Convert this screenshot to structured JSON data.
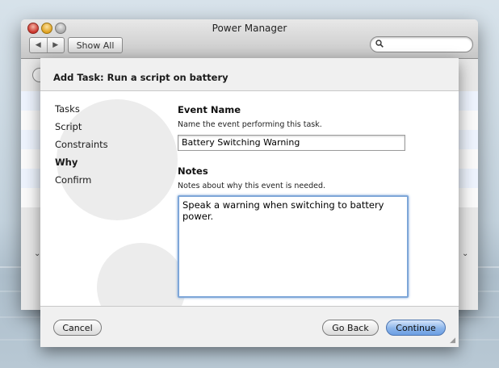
{
  "window": {
    "title": "Power Manager",
    "show_all_label": "Show All",
    "back_arrow": "◀",
    "forward_arrow": "▶",
    "search_placeholder": "",
    "search_icon_glyph": "🔍"
  },
  "sheet": {
    "title": "Add Task: Run a script on battery",
    "steps": [
      {
        "label": "Tasks",
        "current": false
      },
      {
        "label": "Script",
        "current": false
      },
      {
        "label": "Constraints",
        "current": false
      },
      {
        "label": "Why",
        "current": true
      },
      {
        "label": "Confirm",
        "current": false
      }
    ],
    "event_name": {
      "label": "Event Name",
      "help": "Name the event performing this task.",
      "value": "Battery Switching Warning"
    },
    "notes": {
      "label": "Notes",
      "help": "Notes about why this event is needed.",
      "value": "Speak a warning when switching to battery power."
    },
    "buttons": {
      "cancel": "Cancel",
      "go_back": "Go Back",
      "continue": "Continue"
    }
  },
  "colors": {
    "accent": "#7ea6d8",
    "default_button": "#6c9ee3"
  }
}
